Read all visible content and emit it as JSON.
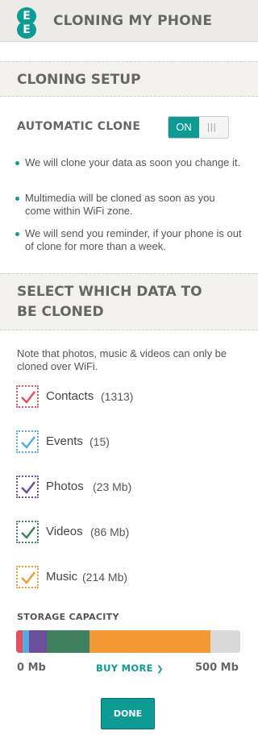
{
  "header": {
    "title": "CLONING MY PHONE",
    "logo_letters": [
      "E",
      "E"
    ]
  },
  "setup": {
    "heading": "CLONING SETUP",
    "auto_clone_label": "AUTOMATIC CLONE",
    "toggle": {
      "state": "ON",
      "grip": "|||"
    },
    "bullets": [
      "We will clone your data as soon you change it.",
      "Multimedia will be cloned as soon as you come within WiFi zone.",
      "We will send you reminder, if your phone is out of clone for more than a week."
    ]
  },
  "select": {
    "heading_line1": "SELECT WHICH DATA TO",
    "heading_line2": "BE CLONED",
    "note": "Note that photos, music & videos can only be cloned over WiFi.",
    "items": [
      {
        "label": "Contacts",
        "count": "(1313)",
        "checked": true,
        "color": "#e0525f"
      },
      {
        "label": "Events",
        "count": "(15)",
        "checked": true,
        "color": "#5ba8e0"
      },
      {
        "label": "Photos",
        "count": "(23 Mb)",
        "checked": true,
        "color": "#6b4e9c"
      },
      {
        "label": "Videos",
        "count": "(86 Mb)",
        "checked": true,
        "color": "#3f8060"
      },
      {
        "label": "Music",
        "count": "(214 Mb)",
        "checked": true,
        "color": "#f39a37"
      }
    ]
  },
  "storage": {
    "label": "STORAGE CAPACITY",
    "min_label": "0 Mb",
    "max_label": "500 Mb",
    "buy_more": "BUY MORE",
    "buy_more_chevron": "❯",
    "segments": [
      {
        "name": "Contacts",
        "fraction": 0.03,
        "color": "#e0525f"
      },
      {
        "name": "Events",
        "fraction": 0.03,
        "color": "#5ba8e0"
      },
      {
        "name": "Photos",
        "fraction": 0.08,
        "color": "#6b4e9c"
      },
      {
        "name": "Videos",
        "fraction": 0.19,
        "color": "#3f8060"
      },
      {
        "name": "Music",
        "fraction": 0.54,
        "color": "#f39a37"
      },
      {
        "name": "Free",
        "fraction": 0.13,
        "color": "#d9d9d9"
      }
    ]
  },
  "done_label": "DONE"
}
